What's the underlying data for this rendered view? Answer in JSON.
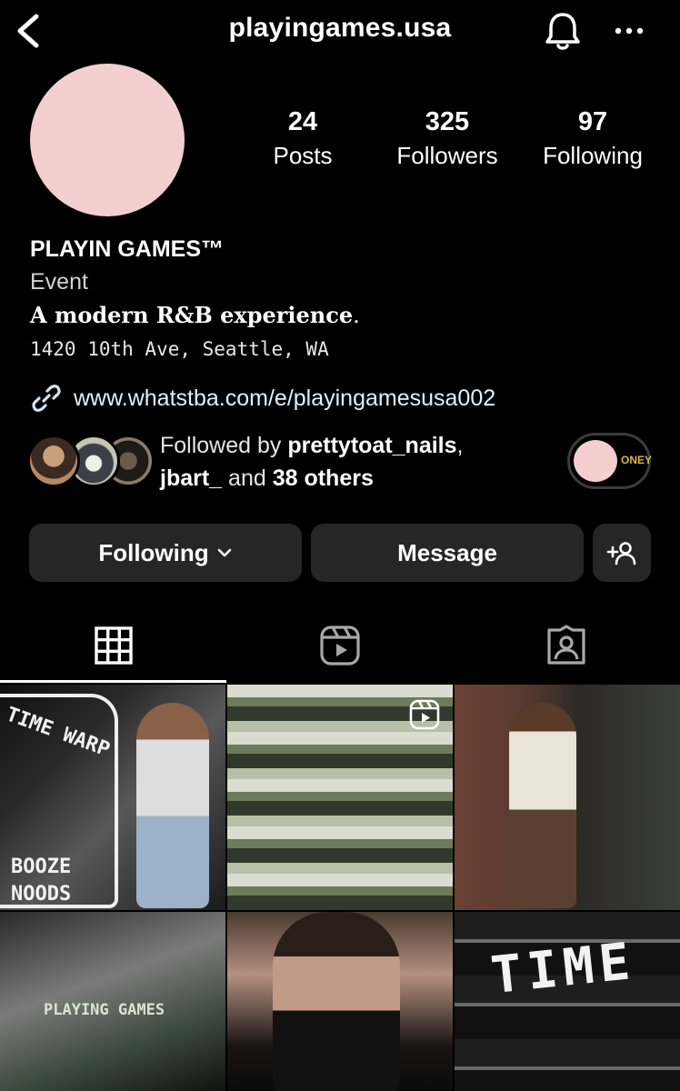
{
  "header": {
    "username": "playingames.usa"
  },
  "profile": {
    "stats": [
      {
        "value": "24",
        "label": "Posts"
      },
      {
        "value": "325",
        "label": "Followers"
      },
      {
        "value": "97",
        "label": "Following"
      }
    ],
    "display_name": "PLAYIN GAMES™",
    "category": "Event",
    "tagline": "A modern R&B experience",
    "tagline_end": ".",
    "address": "1420 10th Ave, Seattle, WA",
    "link": "www.whatstba.com/e/playingamesusa002",
    "followed_by": {
      "prefix": "Followed by ",
      "user1": "prettytoat_nails",
      "sep": ",",
      "user2": "jbart_",
      "mid": " and ",
      "others": "38 others"
    },
    "toggle_label": "ONEY"
  },
  "actions": {
    "following_label": "Following",
    "message_label": "Message"
  },
  "tabs": [
    {
      "icon": "grid-icon",
      "active": true
    },
    {
      "icon": "reels-icon",
      "active": false
    },
    {
      "icon": "tagged-icon",
      "active": false
    }
  ],
  "grid_text": {
    "time_sign": "TIME WARP",
    "booze": "BOOZE",
    "noods": "NOODS",
    "playing": "PLAYING GAMES",
    "time_big": "TIME"
  },
  "colors": {
    "background": "#000000",
    "button": "#262626",
    "avatar": "#f4cfcf",
    "link": "#e0f1ff"
  }
}
